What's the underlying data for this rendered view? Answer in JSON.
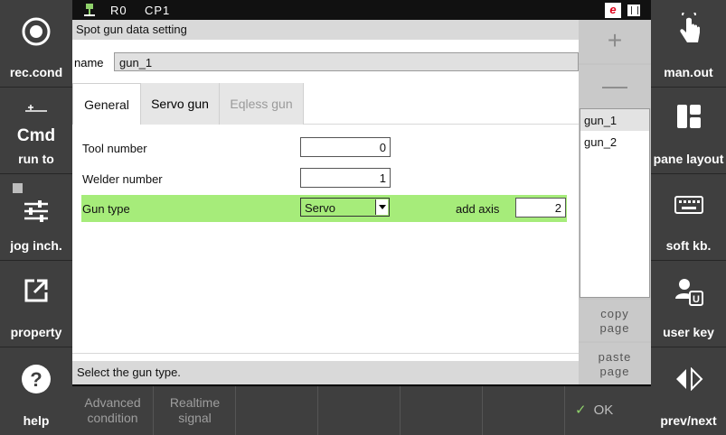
{
  "left_panel": {
    "buttons": [
      {
        "label": "rec.cond",
        "icon": "record-icon"
      },
      {
        "label": "run to",
        "sub": "Cmd",
        "icon": "cmd-icon"
      },
      {
        "label": "jog inch.",
        "icon": "sliders-icon"
      },
      {
        "label": "property",
        "icon": "external-link-icon"
      },
      {
        "label": "help",
        "icon": "help-icon"
      }
    ]
  },
  "right_panel": {
    "buttons": [
      {
        "label": "man.out",
        "icon": "touch-hand-icon"
      },
      {
        "label": "pane layout",
        "icon": "pane-layout-icon"
      },
      {
        "label": "soft kb.",
        "icon": "keyboard-icon"
      },
      {
        "label": "user key",
        "icon": "user-key-icon"
      },
      {
        "label": "prev/next",
        "icon": "prev-next-icon"
      }
    ]
  },
  "status_bar": {
    "robot": "R0",
    "coord": "CP1",
    "mode_badge": "e"
  },
  "dialog": {
    "title": "Spot gun data setting",
    "name_label": "name",
    "name_value": "gun_1",
    "tabs": [
      {
        "label": "General",
        "state": "active"
      },
      {
        "label": "Servo gun",
        "state": "normal"
      },
      {
        "label": "Eqless gun",
        "state": "disabled"
      }
    ],
    "fields": {
      "tool_number": {
        "label": "Tool number",
        "value": "0"
      },
      "welder_number": {
        "label": "Welder number",
        "value": "1"
      },
      "gun_type": {
        "label": "Gun type",
        "value": "Servo",
        "add_axis_label": "add axis",
        "add_axis_value": "2"
      }
    },
    "status_message": "Select the gun type."
  },
  "list_panel": {
    "plus": "+",
    "minus": "—",
    "items": [
      "gun_1",
      "gun_2"
    ],
    "selected": "gun_1",
    "copy_page": "copy page",
    "paste_page": "paste page"
  },
  "bottom_bar": {
    "keys": [
      "Advanced condition",
      "Realtime signal",
      "",
      "",
      "",
      ""
    ],
    "ok": "OK"
  },
  "colors": {
    "highlight": "#a6ec7a",
    "panel": "#3f3f3f",
    "badge_red": "#e0001a"
  }
}
